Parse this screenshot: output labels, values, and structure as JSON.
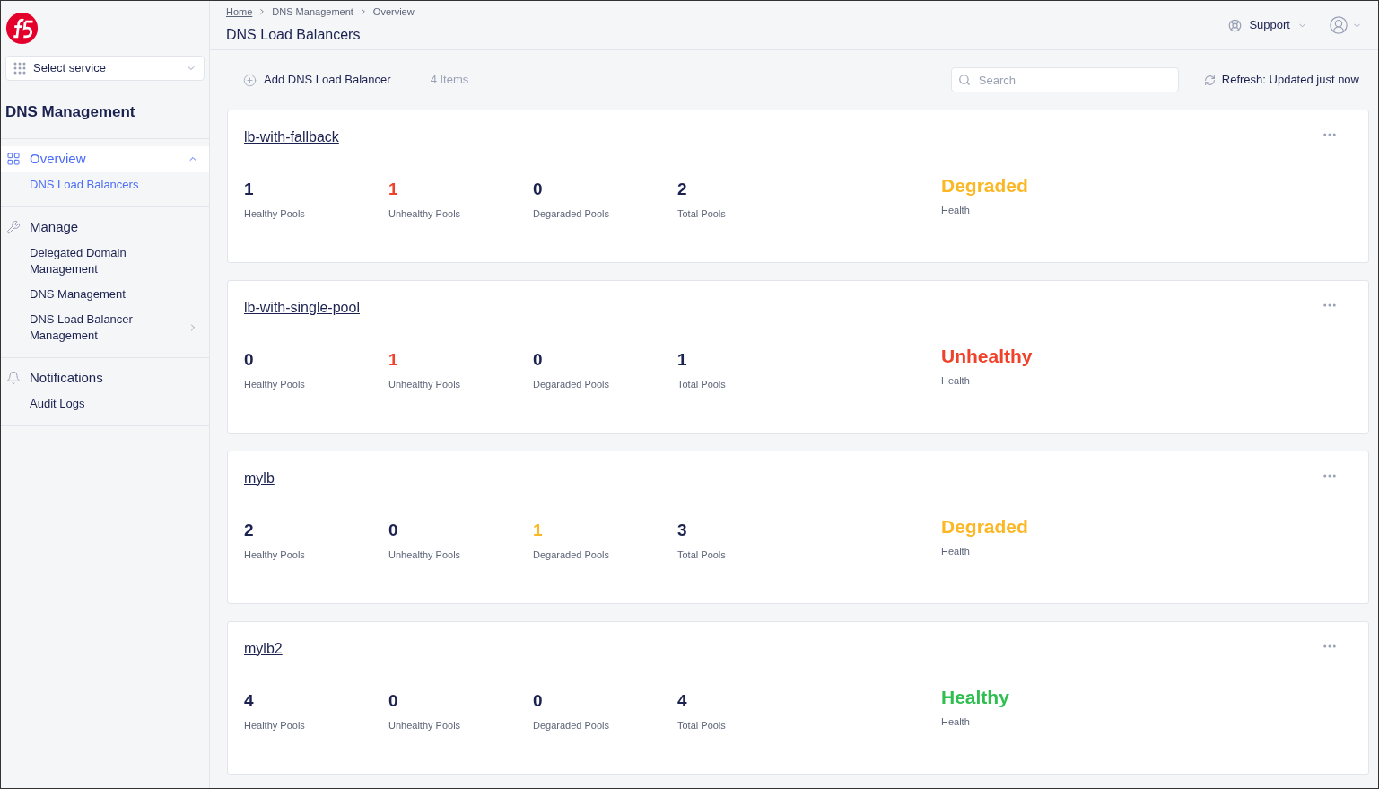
{
  "sidebar": {
    "service_select": {
      "placeholder": "Select service"
    },
    "title": "DNS Management",
    "sections": [
      {
        "label": "Overview",
        "selected": true,
        "expanded": true,
        "items": [
          {
            "label": "DNS Load Balancers",
            "selected": true,
            "has_submenu": false
          }
        ]
      },
      {
        "label": "Manage",
        "selected": false,
        "expanded": false,
        "items": [
          {
            "label": "Delegated Domain Management",
            "selected": false,
            "has_submenu": false
          },
          {
            "label": "DNS Management",
            "selected": false,
            "has_submenu": false
          },
          {
            "label": "DNS Load Balancer Management",
            "selected": false,
            "has_submenu": true
          }
        ]
      },
      {
        "label": "Notifications",
        "selected": false,
        "expanded": false,
        "items": [
          {
            "label": "Audit Logs",
            "selected": false,
            "has_submenu": false
          }
        ]
      }
    ]
  },
  "breadcrumbs": [
    "Home",
    "DNS Management",
    "Overview"
  ],
  "page_title": "DNS Load Balancers",
  "header_actions": {
    "support": "Support"
  },
  "toolbar": {
    "add_button": "Add DNS Load Balancer",
    "count": "4 Items",
    "search": {
      "placeholder": "Search"
    },
    "refresh": "Refresh: Updated just now"
  },
  "load_balancers": [
    {
      "name": "lb-with-fallback",
      "stats": [
        {
          "value": "1",
          "label": "Healthy Pools",
          "kind": "neutral"
        },
        {
          "value": "1",
          "label": "Unhealthy Pools",
          "kind": "unhealthy"
        },
        {
          "value": "0",
          "label": "Degaraded Pools",
          "kind": "neutral"
        },
        {
          "value": "2",
          "label": "Total Pools",
          "kind": "neutral"
        }
      ],
      "health": {
        "value": "Degraded",
        "label": "Health",
        "kind": "degraded"
      }
    },
    {
      "name": "lb-with-single-pool",
      "stats": [
        {
          "value": "0",
          "label": "Healthy Pools",
          "kind": "neutral"
        },
        {
          "value": "1",
          "label": "Unhealthy Pools",
          "kind": "unhealthy"
        },
        {
          "value": "0",
          "label": "Degaraded Pools",
          "kind": "neutral"
        },
        {
          "value": "1",
          "label": "Total Pools",
          "kind": "neutral"
        }
      ],
      "health": {
        "value": "Unhealthy",
        "label": "Health",
        "kind": "unhealthy"
      }
    },
    {
      "name": "mylb",
      "stats": [
        {
          "value": "2",
          "label": "Healthy Pools",
          "kind": "neutral"
        },
        {
          "value": "0",
          "label": "Unhealthy Pools",
          "kind": "neutral"
        },
        {
          "value": "1",
          "label": "Degaraded Pools",
          "kind": "degraded"
        },
        {
          "value": "3",
          "label": "Total Pools",
          "kind": "neutral"
        }
      ],
      "health": {
        "value": "Degraded",
        "label": "Health",
        "kind": "degraded"
      }
    },
    {
      "name": "mylb2",
      "stats": [
        {
          "value": "4",
          "label": "Healthy Pools",
          "kind": "neutral"
        },
        {
          "value": "0",
          "label": "Unhealthy Pools",
          "kind": "neutral"
        },
        {
          "value": "0",
          "label": "Degaraded Pools",
          "kind": "neutral"
        },
        {
          "value": "4",
          "label": "Total Pools",
          "kind": "neutral"
        }
      ],
      "health": {
        "value": "Healthy",
        "label": "Health",
        "kind": "healthy"
      }
    }
  ]
}
